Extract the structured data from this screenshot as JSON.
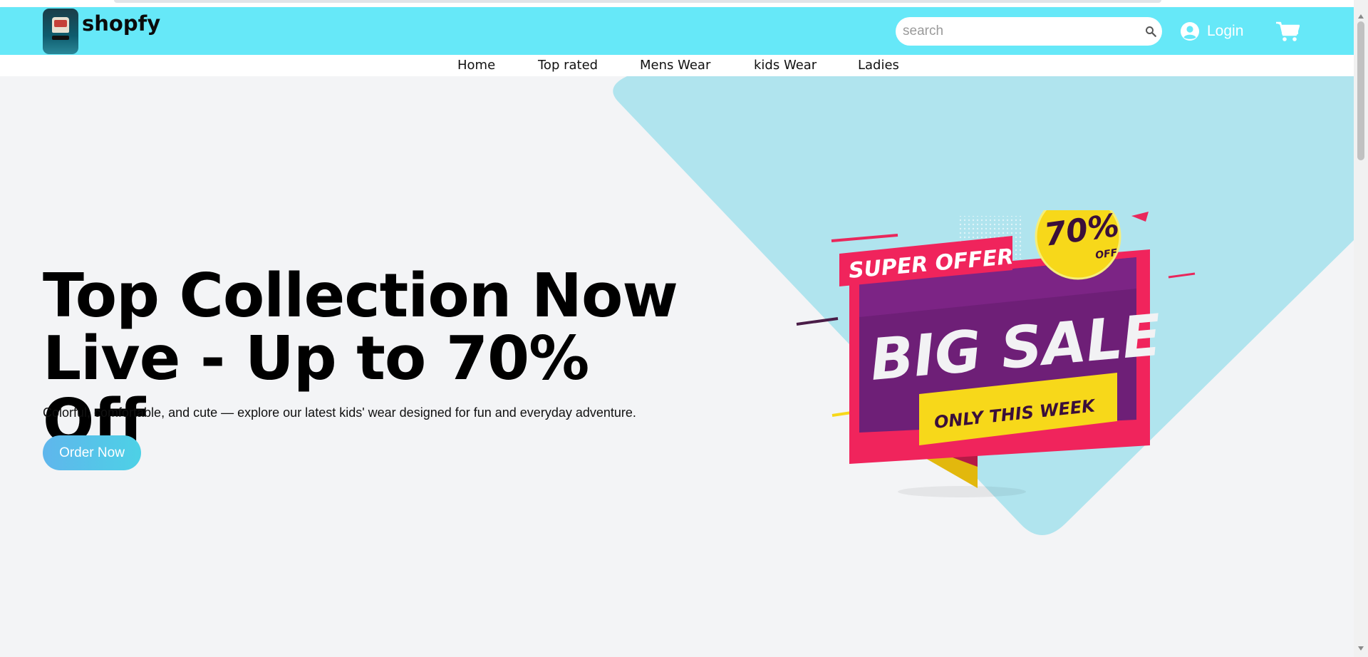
{
  "brand": {
    "name": "shopfy"
  },
  "search": {
    "placeholder": "search",
    "value": ""
  },
  "header": {
    "login_label": "Login"
  },
  "nav": {
    "items": [
      "Home",
      "Top rated",
      "Mens Wear",
      "kids Wear",
      "Ladies"
    ]
  },
  "hero": {
    "title_line1": "Top Collection Now",
    "title_line2": "Live - Up to 70% Off",
    "subtitle": "Colorful, comfortable, and cute — explore our latest kids' wear designed for fun and everyday adventure.",
    "cta_label": "Order Now"
  },
  "sale_banner": {
    "badge": "70%",
    "badge_small": "OFF",
    "tag": "SUPER OFFER",
    "headline": "BIG SALE",
    "ribbon": "ONLY THIS WEEK"
  },
  "colors": {
    "header_bg": "#66e8f8",
    "hero_shape": "#b0e4ee",
    "cta_start": "#5fb6ec",
    "cta_end": "#4dd1e6",
    "sale_purple": "#6e1f77",
    "sale_pink": "#f0245c",
    "sale_yellow": "#f7d81a"
  },
  "icons": {
    "search": "search-icon",
    "user": "user-circle-icon",
    "cart": "cart-icon"
  }
}
